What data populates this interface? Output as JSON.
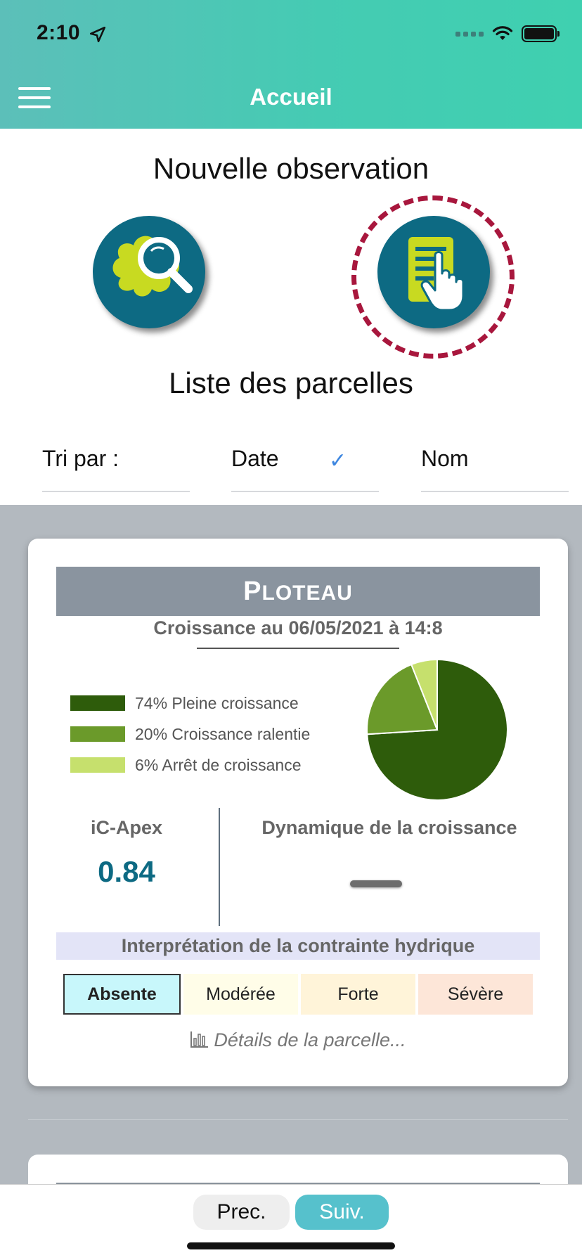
{
  "status_bar": {
    "time": "2:10"
  },
  "header": {
    "title": "Accueil"
  },
  "new_observation": {
    "title": "Nouvelle observation"
  },
  "parcel_list": {
    "title": "Liste des parcelles"
  },
  "sort": {
    "label": "Tri par :",
    "date": "Date",
    "name": "Nom",
    "selected_check": "✓"
  },
  "card": {
    "plot_name": "Ploteau",
    "growth_date": "Croissance au 06/05/2021 à 14:8",
    "legend": [
      {
        "label": "74% Pleine croissance",
        "color": "#2e5c0b"
      },
      {
        "label": "20% Croissance ralentie",
        "color": "#6b9a2a"
      },
      {
        "label": "6% Arrêt de croissance",
        "color": "#c6e06d"
      }
    ],
    "apex_title": "iC-Apex",
    "apex_value": "0.84",
    "dynamic_title": "Dynamique de la croissance",
    "hydric_title": "Interprétation de la contrainte hydrique",
    "stress_levels": [
      "Absente",
      "Modérée",
      "Forte",
      "Sévère"
    ],
    "selected_stress": "Absente",
    "details_link": "Détails de la parcelle..."
  },
  "chart_data": {
    "type": "pie",
    "categories": [
      "Pleine croissance",
      "Croissance ralentie",
      "Arrêt de croissance"
    ],
    "values": [
      74,
      20,
      6
    ],
    "colors": [
      "#2e5c0b",
      "#6b9a2a",
      "#c6e06d"
    ]
  },
  "bottom_nav": {
    "prev_label": "Prec.",
    "next_label": "Suiv."
  },
  "colors": {
    "header_start": "#5cbfb9",
    "header_end": "#3fd0b0",
    "accent_teal": "#0d6a83",
    "dashed_ring": "#a8173d",
    "next_button": "#56c1cc"
  }
}
